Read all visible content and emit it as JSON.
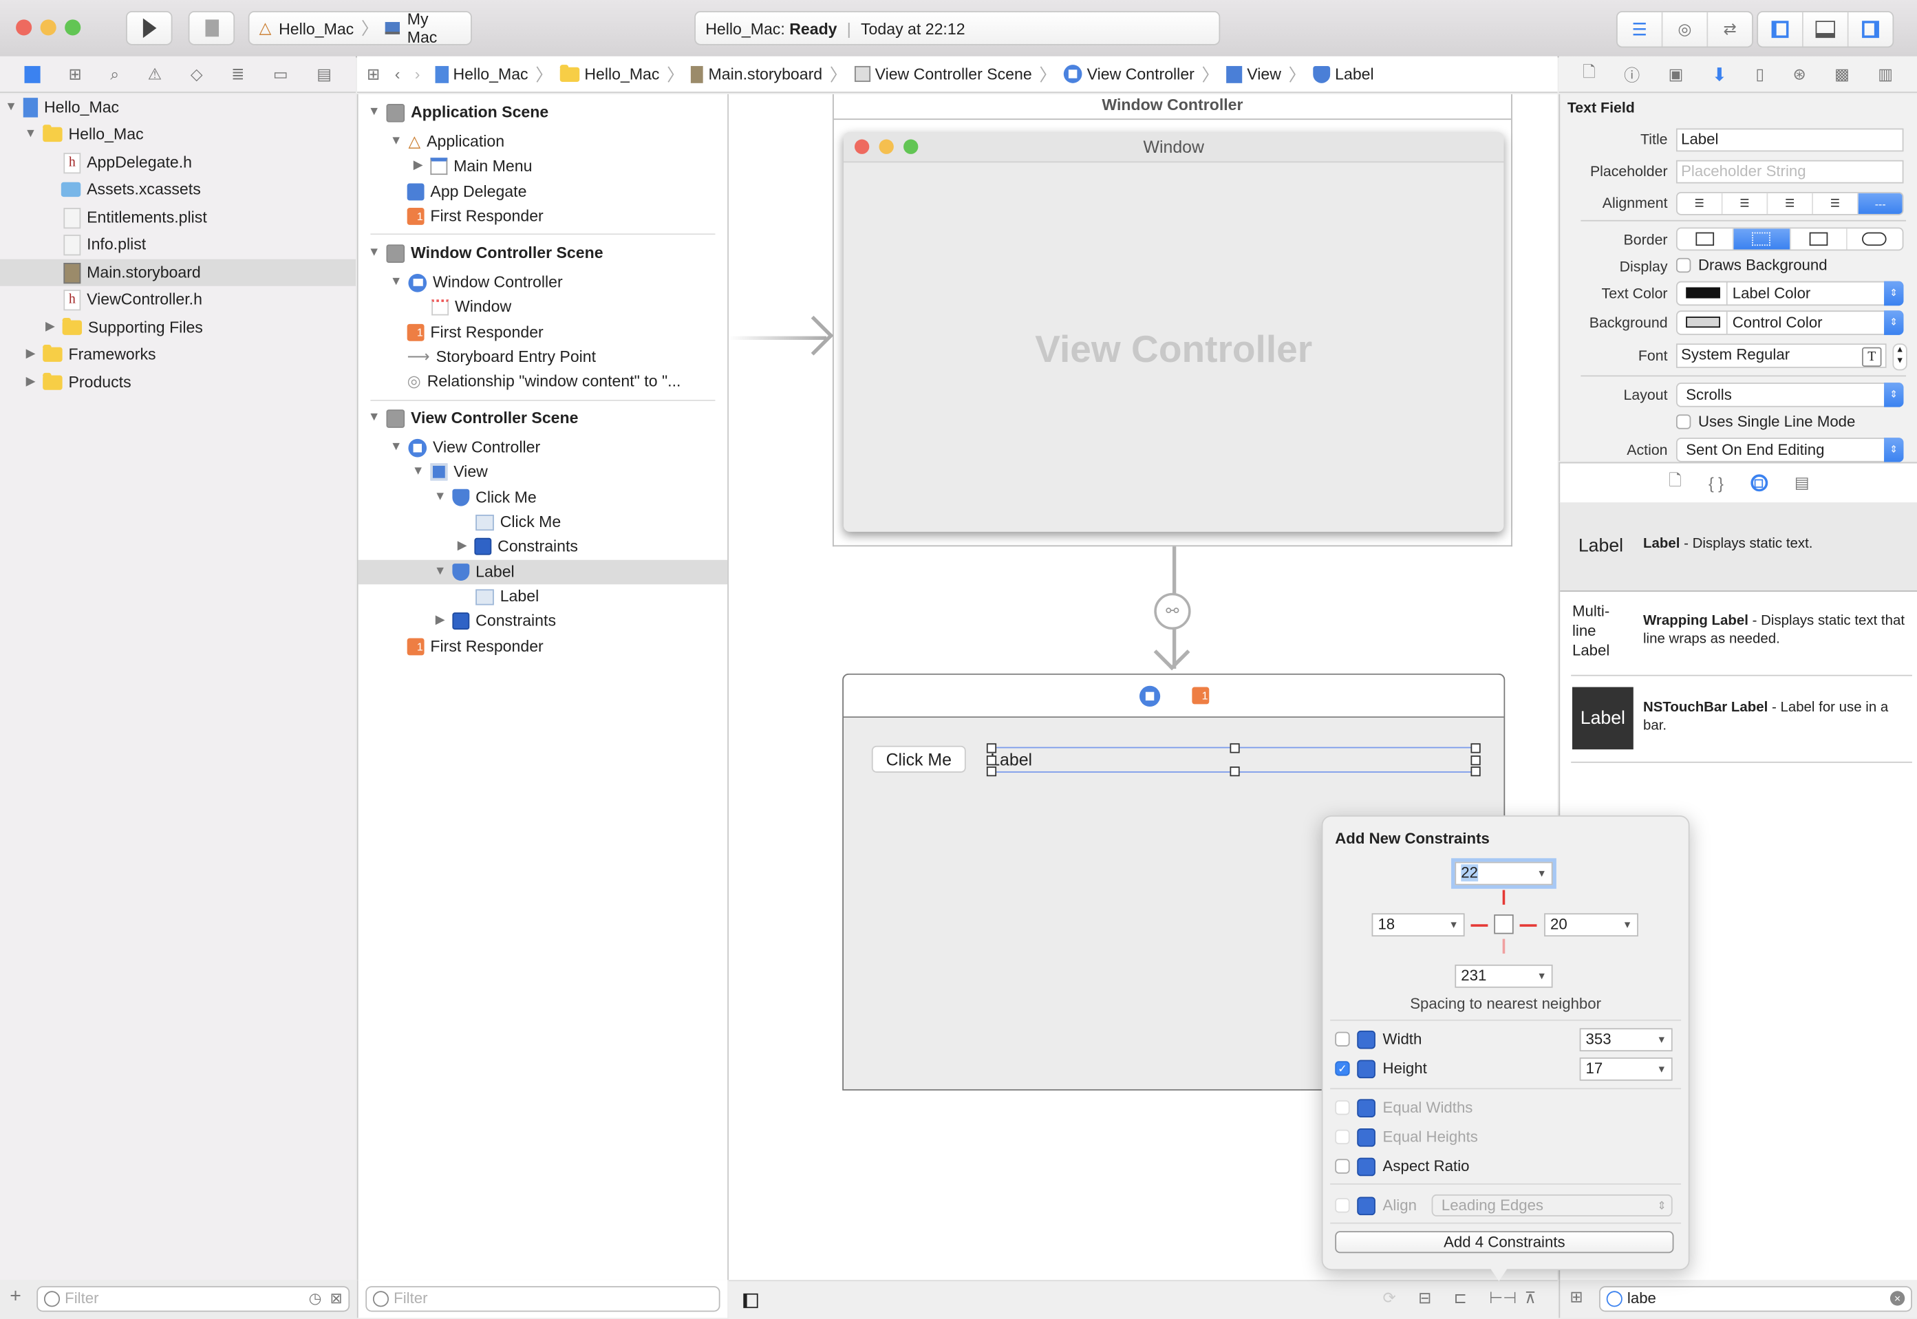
{
  "toolbar": {
    "run_icon": "play-icon",
    "stop_icon": "stop-icon",
    "scheme": "Hello_Mac",
    "destination": "My Mac",
    "activity_project": "Hello_Mac:",
    "activity_status": "Ready",
    "activity_time": "Today at 22:12"
  },
  "navigator_tabs": [
    "project-navigator",
    "symbol-navigator",
    "find-navigator",
    "issue-navigator",
    "test-navigator",
    "debug-navigator",
    "breakpoint-navigator",
    "report-navigator"
  ],
  "jumpbar": {
    "items": [
      "Hello_Mac",
      "Hello_Mac",
      "Main.storyboard",
      "View Controller Scene",
      "View Controller",
      "View",
      "Label"
    ]
  },
  "navigator": {
    "items": [
      {
        "label": "Hello_Mac",
        "type": "project",
        "expanded": true
      },
      {
        "label": "Hello_Mac",
        "type": "folder",
        "expanded": true
      },
      {
        "label": "AppDelegate.h",
        "type": "header"
      },
      {
        "label": "Assets.xcassets",
        "type": "assets"
      },
      {
        "label": "Entitlements.plist",
        "type": "plist"
      },
      {
        "label": "Info.plist",
        "type": "plist"
      },
      {
        "label": "Main.storyboard",
        "type": "storyboard",
        "selected": true
      },
      {
        "label": "ViewController.h",
        "type": "header"
      },
      {
        "label": "Supporting Files",
        "type": "folder",
        "expanded": false
      },
      {
        "label": "Frameworks",
        "type": "folder",
        "expanded": false
      },
      {
        "label": "Products",
        "type": "folder",
        "expanded": false
      }
    ],
    "filter_placeholder": "Filter"
  },
  "outline": {
    "items": [
      {
        "label": "Application Scene",
        "bold": true
      },
      {
        "label": "Application"
      },
      {
        "label": "Main Menu"
      },
      {
        "label": "App Delegate"
      },
      {
        "label": "First Responder"
      },
      {
        "label": "Window Controller Scene",
        "bold": true
      },
      {
        "label": "Window Controller"
      },
      {
        "label": "Window"
      },
      {
        "label": "First Responder"
      },
      {
        "label": "Storyboard Entry Point"
      },
      {
        "label": "Relationship \"window content\" to \"..."
      },
      {
        "label": "View Controller Scene",
        "bold": true
      },
      {
        "label": "View Controller"
      },
      {
        "label": "View"
      },
      {
        "label": "Click Me"
      },
      {
        "label": "Click Me"
      },
      {
        "label": "Constraints"
      },
      {
        "label": "Label",
        "selected": true
      },
      {
        "label": "Label"
      },
      {
        "label": "Constraints"
      },
      {
        "label": "First Responder"
      }
    ],
    "filter_placeholder": "Filter"
  },
  "canvas": {
    "window_controller_title": "Window Controller",
    "window_title": "Window",
    "view_controller_placeholder": "View Controller",
    "button_label": "Click Me",
    "label_text": "Label"
  },
  "popover": {
    "title": "Add New Constraints",
    "top": "22",
    "left": "18",
    "right": "20",
    "bottom": "231",
    "spacing_caption": "Spacing to nearest neighbor",
    "width_label": "Width",
    "width_value": "353",
    "width_checked": false,
    "height_label": "Height",
    "height_value": "17",
    "height_checked": true,
    "equal_widths": "Equal Widths",
    "equal_heights": "Equal Heights",
    "aspect_ratio": "Aspect Ratio",
    "align_label": "Align",
    "align_value": "Leading Edges",
    "add_button": "Add 4 Constraints"
  },
  "inspector": {
    "section_title": "Text Field",
    "title_label": "Title",
    "title_value": "Label",
    "placeholder_label": "Placeholder",
    "placeholder_hint": "Placeholder String",
    "alignment_label": "Alignment",
    "alignment_selected": "natural",
    "border_label": "Border",
    "border_selected": "dotted",
    "display_label": "Display",
    "draws_background": "Draws Background",
    "text_color_label": "Text Color",
    "text_color_value": "Label Color",
    "background_label": "Background",
    "background_value": "Control Color",
    "font_label": "Font",
    "font_value": "System Regular",
    "layout_label": "Layout",
    "layout_value": "Scrolls",
    "single_line": "Uses Single Line Mode",
    "action_label": "Action",
    "action_value": "Sent On End Editing"
  },
  "library": {
    "items": [
      {
        "preview": "Label",
        "name": "Label",
        "desc": " - Displays static text."
      },
      {
        "preview": "Multi-line Label",
        "name": "Wrapping Label",
        "desc": " - Displays static text that line wraps as needed."
      },
      {
        "preview": "Label",
        "name": "NSTouchBar Label",
        "desc": " - Label for use in a bar."
      }
    ],
    "search_value": "labe"
  },
  "colors": {
    "accent": "#3b82f0",
    "selection_row": "#dcdcdc",
    "constraint_red": "#e53935",
    "first_responder": "#ee7e43"
  }
}
